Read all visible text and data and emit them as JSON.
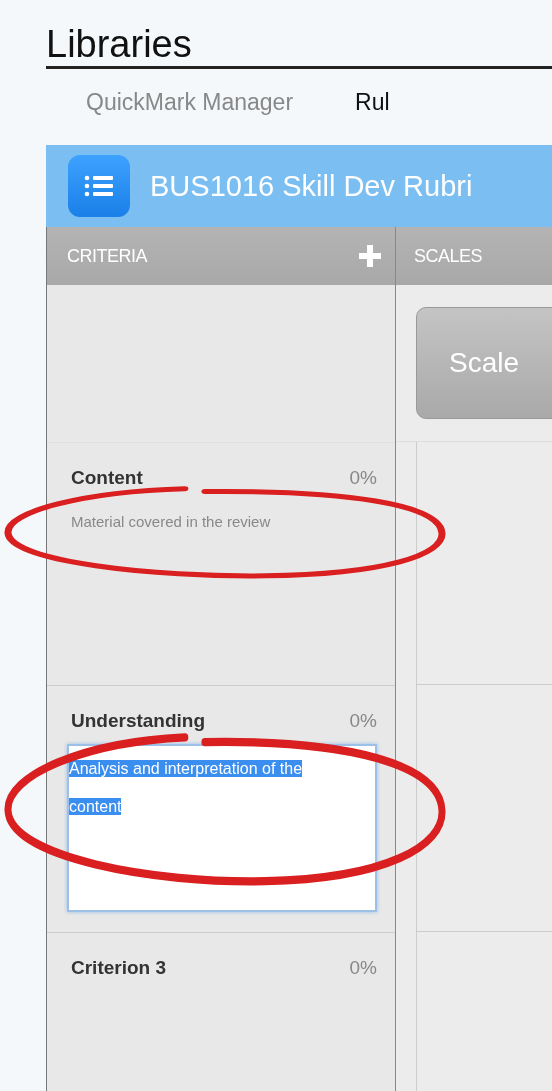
{
  "page": {
    "heading": "Libraries"
  },
  "tabs": [
    {
      "label": "QuickMark Manager",
      "selected": false
    },
    {
      "label": "Rul",
      "selected": true
    }
  ],
  "rubric": {
    "title": "BUS1016 Skill Dev Rubri"
  },
  "criteria_header": {
    "label": "CRITERIA"
  },
  "scales_header": {
    "label": "SCALES"
  },
  "scales": [
    {
      "label": "Scale"
    }
  ],
  "criteria": [
    {
      "name": "Content",
      "weight": "0%",
      "description": "Material covered in the review",
      "editing": false,
      "circled": true
    },
    {
      "name": "Understanding",
      "weight": "0%",
      "description": "Analysis and interpretation of the content",
      "editing": true,
      "circled": true
    },
    {
      "name": "Criterion 3",
      "weight": "0%",
      "editing": false,
      "circled": false
    }
  ]
}
